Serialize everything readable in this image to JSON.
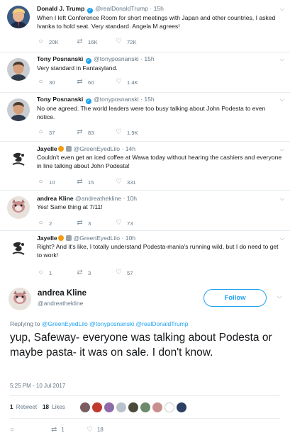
{
  "thread": [
    {
      "name": "Donald J. Trump",
      "verified": true,
      "handle": "@realDonaldTrump",
      "time": "15h",
      "text": "When I left Conference Room for short meetings with Japan and other countries, I asked Ivanka to hold seat. Very standard. Angela M agrees!",
      "replies": "20K",
      "retweets": "16K",
      "likes": "72K"
    },
    {
      "name": "Tony Posnanski",
      "verified": true,
      "handle": "@tonyposnanski",
      "time": "15h",
      "text": "Very standard in Fantasyland.",
      "replies": "30",
      "retweets": "60",
      "likes": "1.4K"
    },
    {
      "name": "Tony Posnanski",
      "verified": true,
      "handle": "@tonyposnanski",
      "time": "15h",
      "text": "No one agreed. The world leaders were too busy talking about John Podesta to even notice.",
      "replies": "37",
      "retweets": "83",
      "likes": "1.9K"
    },
    {
      "name": "Jayelle",
      "verified": false,
      "handle": "@GreenEyedLilo",
      "time": "14h",
      "text": "Couldn't even get an iced coffee at Wawa today without hearing the cashiers and everyone in line talking about John Podesta!",
      "replies": "10",
      "retweets": "15",
      "likes": "331"
    },
    {
      "name": "andrea Kline",
      "verified": false,
      "handle": "@andreathekline",
      "time": "10h",
      "text": "Yes! Same thing at 7/11!",
      "replies": "2",
      "retweets": "3",
      "likes": "73"
    },
    {
      "name": "Jayelle",
      "verified": false,
      "handle": "@GreenEyedLilo",
      "time": "10h",
      "text": "Right? And it's like, I totally understand Podesta-mania's running wild, but I do need to get to work!",
      "replies": "1",
      "retweets": "3",
      "likes": "57"
    }
  ],
  "main": {
    "name": "andrea Kline",
    "handle": "@andreathekline",
    "follow_label": "Follow",
    "replying_prefix": "Replying to",
    "replying_to": [
      "@GreenEyedLilo",
      "@tonyposnanski",
      "@realDonaldTrump"
    ],
    "text": "yup, Safeway- everyone was talking about Podesta or maybe pasta- it was on sale. I don't know.",
    "timestamp": "5:25 PM - 10 Jul 2017",
    "retweets_count": "1",
    "retweets_label": "Retweet",
    "likes_count": "18",
    "likes_label": "Likes",
    "action_retweets": "1",
    "action_likes": "18"
  },
  "icons": {
    "reply": "reply-icon",
    "retweet": "retweet-icon",
    "like": "heart-icon",
    "more": "chevron-down-icon",
    "verified": "verified-badge-icon"
  },
  "colors": {
    "link": "#1da1f2",
    "muted": "#657786",
    "text": "#14171a",
    "border": "#e6ecf0"
  }
}
